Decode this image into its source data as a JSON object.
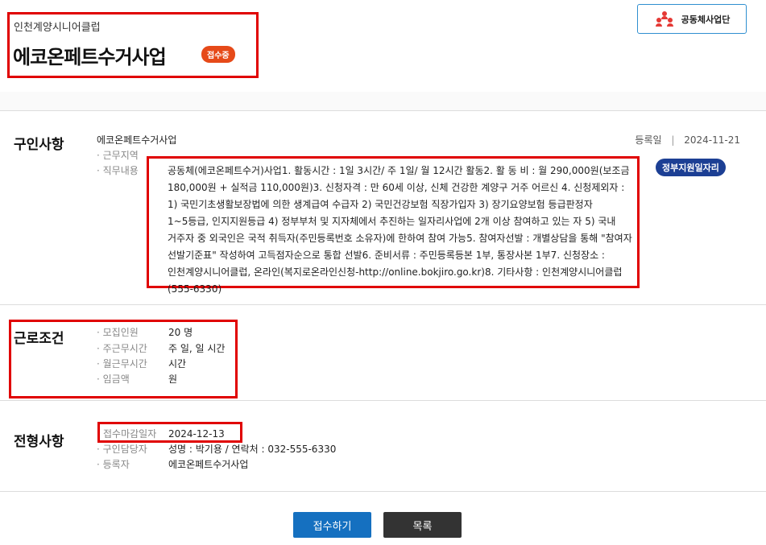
{
  "header": {
    "org_name": "인천계양시니어클럽",
    "title": "에코온페트수거사업",
    "status_badge": "접수중",
    "org_button_label": "공동체사업단"
  },
  "recruit": {
    "section_title": "구인사항",
    "company": "에코온페트수거사업",
    "reg_label": "등록일",
    "reg_date": "2024-11-21",
    "gov_badge": "정부지원일자리",
    "work_area_label": "· 근무지역",
    "work_area_value": "",
    "duty_label": "· 직무내용",
    "duty_value": "공동체(에코온페트수거)사업1. 활동시간 : 1일 3시간/ 주 1일/ 월 12시간 활동2. 활 동 비 :  월 290,000원(보조금 180,000원 + 실적금 110,000원)3. 신청자격 : 만 60세 이상, 신체 건강한 계양구 거주 어르신 4. 신청제외자 :  1) 국민기초생활보장법에 의한 생계급여 수급자   2) 국민건강보험 직장가입자  3) 장기요양보험 등급판정자 1~5등급, 인지지원등급  4) 정부부처 및 지자체에서 추진하는 일자리사업에 2개 이상 참여하고 있는 자  5) 국내 거주자 중 외국인은 국적 취득자(주민등록번호 소유자)에 한하여 참여 가능5. 참여자선발 : 개별상담을 통해 \"참여자 선발기준표\" 작성하여 고득점자순으로 통합 선발6. 준비서류 : 주민등록등본 1부, 통장사본 1부7. 신청장소 : 인천계양시니어클럽, 온라인(복지로온라인신청-http://online.bokjiro.go.kr)8. 기타사항 : 인천계양시니어클럽(555-6330)"
  },
  "conditions": {
    "section_title": "근로조건",
    "items": [
      {
        "label": "· 모집인원",
        "value": "20 명"
      },
      {
        "label": "· 주근무시간",
        "value": "주 일, 일 시간"
      },
      {
        "label": "· 월근무시간",
        "value": "시간"
      },
      {
        "label": "· 임금액",
        "value": "원"
      }
    ]
  },
  "selection": {
    "section_title": "전형사항",
    "items": [
      {
        "label": "접수마감일자",
        "value": "2024-12-13"
      },
      {
        "label": "· 구인담당자",
        "value": "성명 : 박기용 / 연락처 : 032-555-6330"
      },
      {
        "label": "· 등록자",
        "value": "에코온페트수거사업"
      }
    ]
  },
  "buttons": {
    "apply": "접수하기",
    "list": "목록"
  },
  "colors": {
    "highlight": "#e00000",
    "status_badge": "#e64a19",
    "gov_badge": "#1c3f94",
    "apply_button": "#1570c0",
    "list_button": "#333333"
  }
}
